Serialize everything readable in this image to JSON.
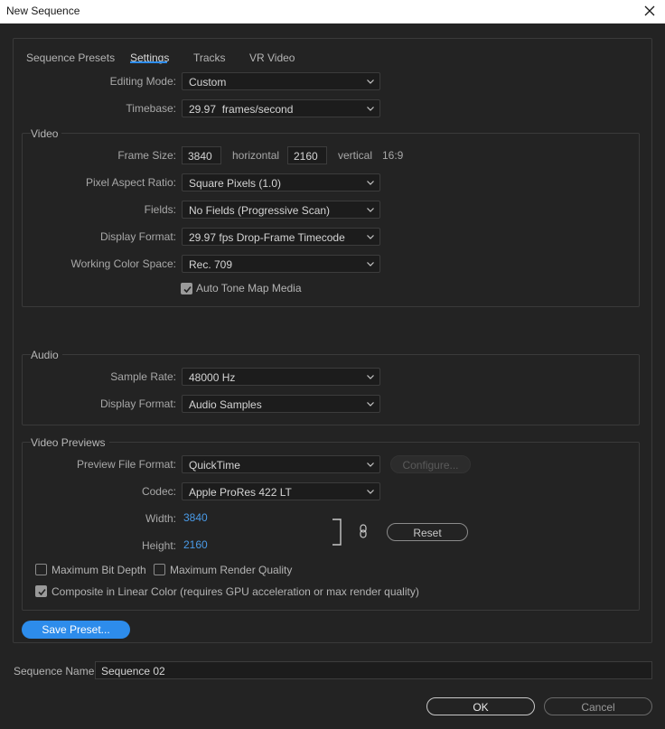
{
  "window": {
    "title": "New Sequence"
  },
  "tabs": [
    {
      "label": "Sequence Presets"
    },
    {
      "label": "Settings"
    },
    {
      "label": "Tracks"
    },
    {
      "label": "VR Video"
    }
  ],
  "active_tab": "Settings",
  "settings": {
    "editing_mode": {
      "label": "Editing Mode:",
      "value": "Custom"
    },
    "timebase": {
      "label": "Timebase:",
      "value": "29.97  frames/second"
    }
  },
  "video": {
    "group_title": "Video",
    "frame_size": {
      "label": "Frame Size:",
      "horizontal_value": "3840",
      "horizontal_label": "horizontal",
      "vertical_value": "2160",
      "vertical_label": "vertical",
      "aspect": "16:9"
    },
    "pixel_aspect_ratio": {
      "label": "Pixel Aspect Ratio:",
      "value": "Square Pixels (1.0)"
    },
    "fields": {
      "label": "Fields:",
      "value": "No Fields (Progressive Scan)"
    },
    "display_format": {
      "label": "Display Format:",
      "value": "29.97 fps Drop-Frame Timecode"
    },
    "working_color_space": {
      "label": "Working Color Space:",
      "value": "Rec. 709"
    },
    "auto_tone_map": {
      "label": "Auto Tone Map Media",
      "checked": true
    }
  },
  "audio": {
    "group_title": "Audio",
    "sample_rate": {
      "label": "Sample Rate:",
      "value": "48000 Hz"
    },
    "display_format": {
      "label": "Display Format:",
      "value": "Audio Samples"
    }
  },
  "video_previews": {
    "group_title": "Video Previews",
    "preview_file_format": {
      "label": "Preview File Format:",
      "value": "QuickTime"
    },
    "configure_label": "Configure...",
    "codec": {
      "label": "Codec:",
      "value": "Apple ProRes 422 LT"
    },
    "width": {
      "label": "Width:",
      "value": "3840"
    },
    "height": {
      "label": "Height:",
      "value": "2160"
    },
    "reset_label": "Reset",
    "max_bit_depth": {
      "label": "Maximum Bit Depth",
      "checked": false
    },
    "max_render_quality": {
      "label": "Maximum Render Quality",
      "checked": false
    },
    "composite_linear": {
      "label": "Composite in Linear Color (requires GPU acceleration or max render quality)",
      "checked": true
    }
  },
  "save_preset_label": "Save Preset...",
  "sequence_name": {
    "label": "Sequence Name:",
    "value": "Sequence 02"
  },
  "ok_label": "OK",
  "cancel_label": "Cancel",
  "colors": {
    "accent": "#2d8ceb",
    "background": "#232323",
    "link_value": "#4a9be8"
  }
}
